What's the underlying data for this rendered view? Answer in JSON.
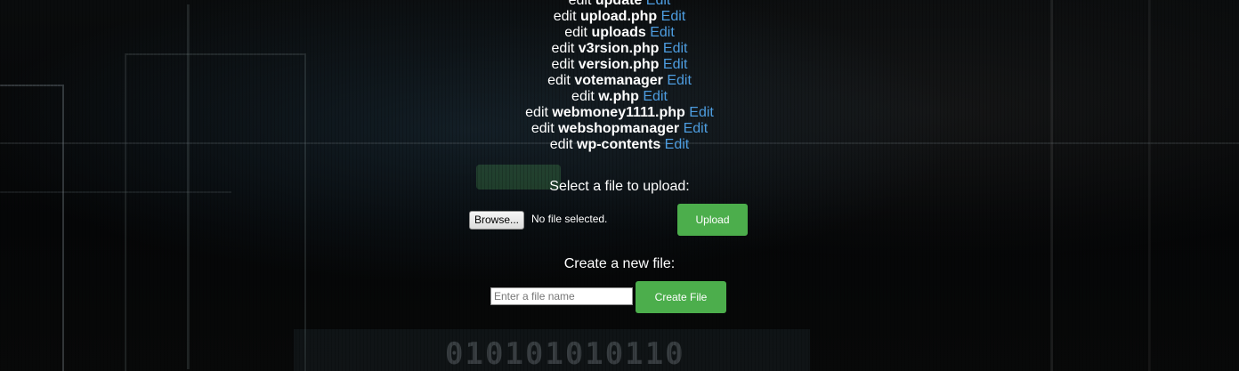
{
  "file_list": [
    {
      "prefix": "edit",
      "name": "update",
      "action": "Edit"
    },
    {
      "prefix": "edit",
      "name": "upload.php",
      "action": "Edit"
    },
    {
      "prefix": "edit",
      "name": "uploads",
      "action": "Edit"
    },
    {
      "prefix": "edit",
      "name": "v3rsion.php",
      "action": "Edit"
    },
    {
      "prefix": "edit",
      "name": "version.php",
      "action": "Edit"
    },
    {
      "prefix": "edit",
      "name": "votemanager",
      "action": "Edit"
    },
    {
      "prefix": "edit",
      "name": "w.php",
      "action": "Edit"
    },
    {
      "prefix": "edit",
      "name": "webmoney1111.php",
      "action": "Edit"
    },
    {
      "prefix": "edit",
      "name": "webshopmanager",
      "action": "Edit"
    },
    {
      "prefix": "edit",
      "name": "wp-contents",
      "action": "Edit"
    }
  ],
  "upload": {
    "label": "Select a file to upload:",
    "browse_label": "Browse...",
    "file_status": "No file selected.",
    "submit_label": "Upload"
  },
  "create": {
    "label": "Create a new file:",
    "input_value": "",
    "input_placeholder": "Enter a file name",
    "submit_label": "Create File"
  },
  "background_text": {
    "binary_strip": "010101010110"
  },
  "colors": {
    "link": "#4d9de0",
    "button_green": "#4cae4c",
    "background": "#050607"
  }
}
